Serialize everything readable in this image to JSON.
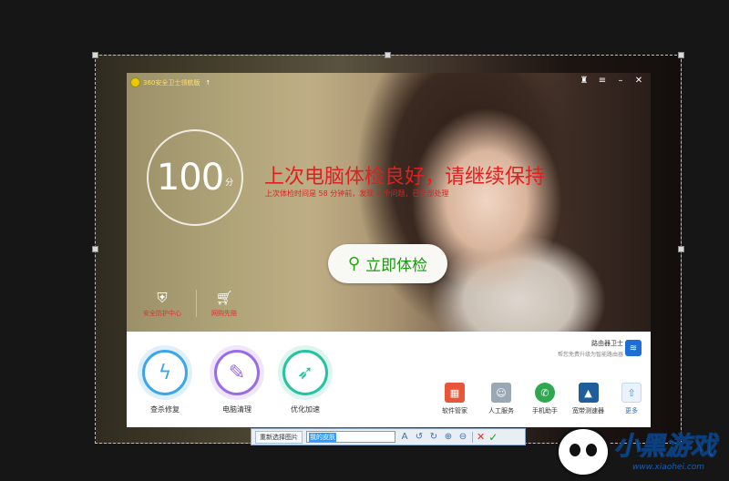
{
  "app": {
    "title": "360安全卫士领航版",
    "window_controls": [
      "shirt-icon",
      "menu-icon",
      "minimize-icon",
      "close-icon"
    ]
  },
  "score": {
    "value": "100",
    "unit": "分"
  },
  "status": {
    "headline": "上次电脑体检良好，请继续保持",
    "subline": "上次体检时间是 58 分钟前，发现 7 个问题，已全部处理"
  },
  "scan_button": {
    "label": "立即体检"
  },
  "quick_links": [
    {
      "label": "安全防护中心",
      "icon": "shield-icon"
    },
    {
      "label": "网购先赔",
      "icon": "cart-icon"
    }
  ],
  "tools": [
    {
      "label": "查杀修复",
      "icon": "lightning-icon",
      "color": "#3da6e8"
    },
    {
      "label": "电脑清理",
      "icon": "broom-icon",
      "color": "#9a6be8"
    },
    {
      "label": "优化加速",
      "icon": "rocket-icon",
      "color": "#27c2a0"
    }
  ],
  "router": {
    "title": "路由器卫士",
    "subtitle": "帮您免费升级为智能路由器"
  },
  "mini_tools": [
    {
      "label": "软件管家",
      "icon": "grid-icon",
      "color": "#e8563a"
    },
    {
      "label": "人工服务",
      "icon": "person-icon",
      "color": "#9aa7b4"
    },
    {
      "label": "手机助手",
      "icon": "phone-icon",
      "color": "#2fa84f"
    },
    {
      "label": "宽带测速器",
      "icon": "road-icon",
      "color": "#1f5e9a"
    },
    {
      "label": "更多",
      "icon": "arrow-up-icon",
      "color": "#eaf2fb"
    }
  ],
  "toolbar": {
    "reselect_label": "重新选择图片",
    "skin_name_value": "我的皮肤",
    "icons": [
      "font-icon",
      "rotate-left-icon",
      "rotate-right-icon",
      "zoom-in-icon",
      "zoom-out-icon",
      "cancel-icon",
      "confirm-icon"
    ]
  },
  "watermark": {
    "title": "小黑游戏",
    "url": "www.xiaohei.com"
  }
}
